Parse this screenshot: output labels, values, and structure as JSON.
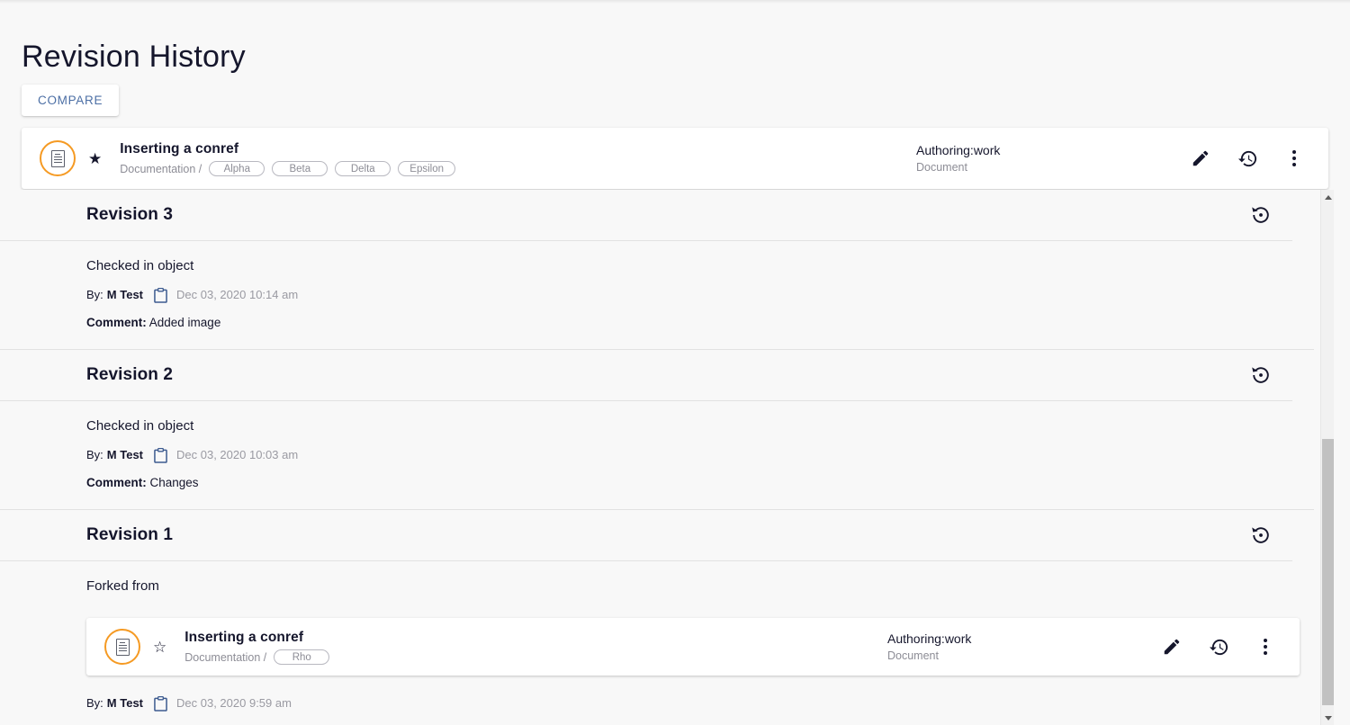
{
  "page": {
    "title": "Revision History"
  },
  "toolbar": {
    "compare_label": "COMPARE"
  },
  "object_card": {
    "icon": "document-icon",
    "favorite_icon": "star-filled-icon",
    "title": "Inserting a conref",
    "breadcrumb": "Documentation /",
    "tags": [
      "Alpha",
      "Beta",
      "Delta",
      "Epsilon"
    ],
    "status": "Authoring:work",
    "type": "Document",
    "actions": [
      {
        "name": "edit-icon",
        "label": "Edit"
      },
      {
        "name": "history-icon",
        "label": "History"
      },
      {
        "name": "more-options-icon",
        "label": "More"
      }
    ]
  },
  "revisions": [
    {
      "heading": "Revision 3",
      "restore_icon": "restore-icon",
      "action": "Checked in object",
      "by_label": "By:",
      "by_user": "M Test",
      "clipboard_icon": "clipboard-icon",
      "timestamp": "Dec 03, 2020 10:14 am",
      "comment_label": "Comment:",
      "comment": "Added image"
    },
    {
      "heading": "Revision 2",
      "restore_icon": "restore-icon",
      "action": "Checked in object",
      "by_label": "By:",
      "by_user": "M Test",
      "clipboard_icon": "clipboard-icon",
      "timestamp": "Dec 03, 2020 10:03 am",
      "comment_label": "Comment:",
      "comment": "Changes"
    }
  ],
  "revision_one": {
    "heading": "Revision 1",
    "restore_icon": "restore-icon",
    "forked_label": "Forked from",
    "by_label": "By:",
    "by_user": "M Test",
    "clipboard_icon": "clipboard-icon",
    "timestamp": "Dec 03, 2020 9:59 am",
    "forked_card": {
      "icon": "document-icon",
      "favorite_icon": "star-outline-icon",
      "title": "Inserting a conref",
      "breadcrumb": "Documentation /",
      "tags": [
        "Rho"
      ],
      "status": "Authoring:work",
      "type": "Document",
      "actions": [
        {
          "name": "edit-icon",
          "label": "Edit"
        },
        {
          "name": "history-icon",
          "label": "History"
        },
        {
          "name": "more-options-icon",
          "label": "More"
        }
      ]
    }
  },
  "colors": {
    "accent_orange": "#f59a23",
    "link_blue": "#4c6fa5",
    "text_dark": "#15162c",
    "text_muted": "#8d8d96",
    "page_bg": "#f8f8f8",
    "card_bg": "#ffffff",
    "divider": "#e2e2e2",
    "scrollbar_thumb": "#c1c1c1"
  },
  "scrollbar": {
    "up_icon": "chevron-up-icon",
    "down_icon": "chevron-down-icon"
  }
}
